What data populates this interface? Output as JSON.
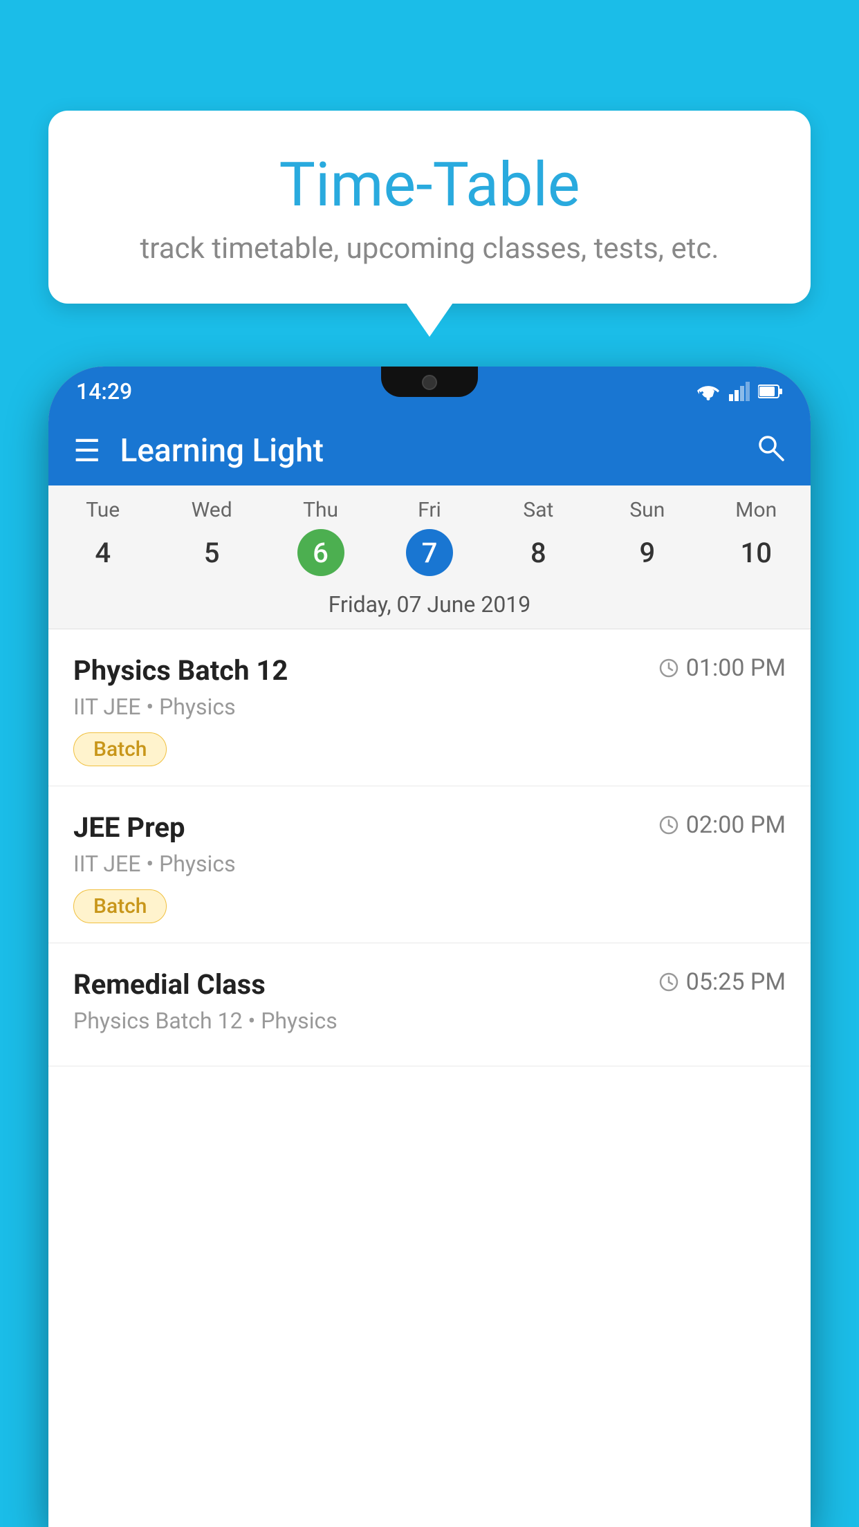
{
  "bubble": {
    "title": "Time-Table",
    "subtitle": "track timetable, upcoming classes, tests, etc."
  },
  "phone": {
    "status_bar": {
      "time": "14:29"
    },
    "app_bar": {
      "title": "Learning Light"
    },
    "calendar": {
      "days": [
        {
          "name": "Tue",
          "number": "4",
          "state": "normal"
        },
        {
          "name": "Wed",
          "number": "5",
          "state": "normal"
        },
        {
          "name": "Thu",
          "number": "6",
          "state": "today"
        },
        {
          "name": "Fri",
          "number": "7",
          "state": "selected"
        },
        {
          "name": "Sat",
          "number": "8",
          "state": "normal"
        },
        {
          "name": "Sun",
          "number": "9",
          "state": "normal"
        },
        {
          "name": "Mon",
          "number": "10",
          "state": "normal"
        }
      ],
      "selected_date_label": "Friday, 07 June 2019"
    },
    "schedule": [
      {
        "title": "Physics Batch 12",
        "time": "01:00 PM",
        "subtitle": "IIT JEE • Physics",
        "badge": "Batch"
      },
      {
        "title": "JEE Prep",
        "time": "02:00 PM",
        "subtitle": "IIT JEE • Physics",
        "badge": "Batch"
      },
      {
        "title": "Remedial Class",
        "time": "05:25 PM",
        "subtitle": "Physics Batch 12 • Physics",
        "badge": null
      }
    ]
  },
  "icons": {
    "hamburger": "☰",
    "search": "🔍",
    "clock": "🕐"
  }
}
